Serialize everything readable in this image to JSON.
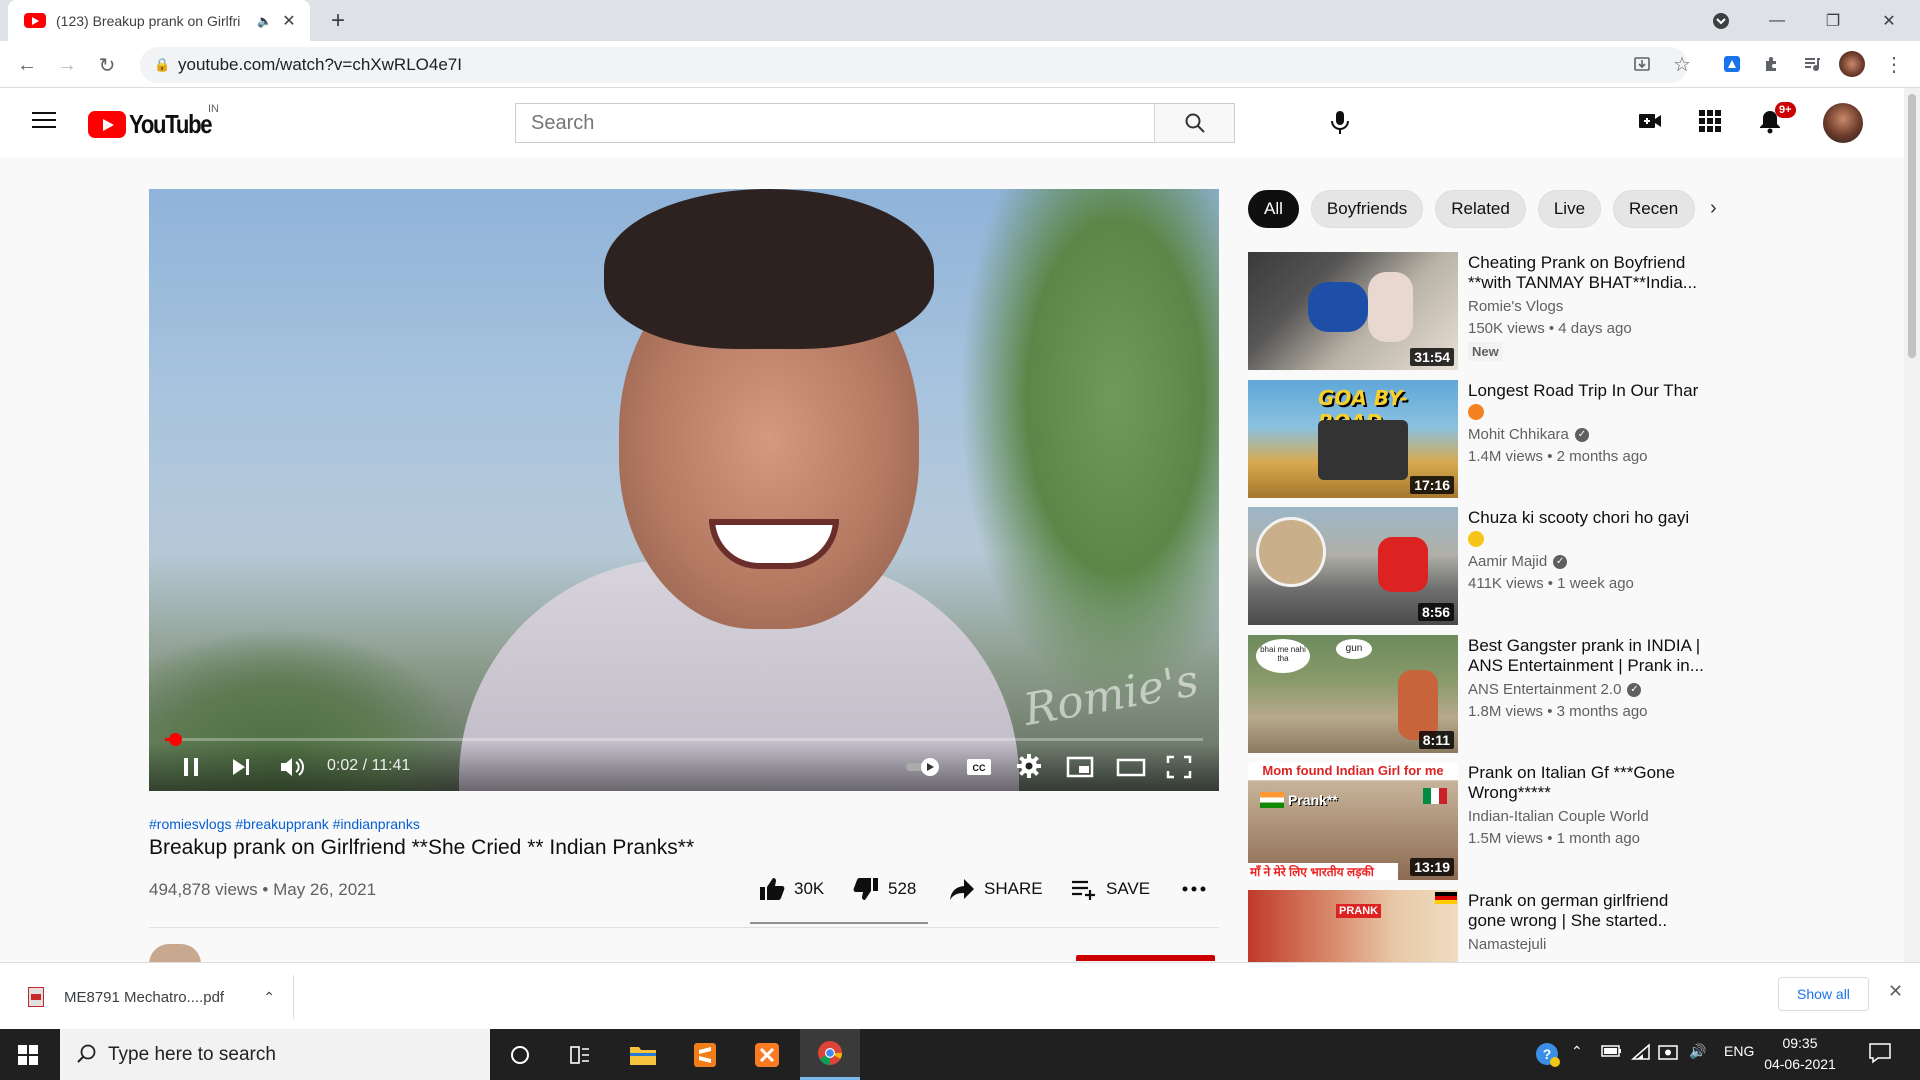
{
  "browser": {
    "tab_title": "(123) Breakup prank on Girlfri",
    "url": "youtube.com/watch?v=chXwRLO4e7I"
  },
  "youtube": {
    "logo_text": "YouTube",
    "country_code": "IN",
    "search_placeholder": "Search",
    "notification_count": "9+"
  },
  "player": {
    "current_time": "0:02 / 11:41",
    "progress": 0.003,
    "watermark": "Romie's"
  },
  "video": {
    "hashtags": "#romiesvlogs #breakupprank #indianpranks",
    "title": "Breakup prank on Girlfriend **She Cried ** Indian Pranks**",
    "stats": "494,878 views • May 26, 2021",
    "likes": "30K",
    "dislikes": "528",
    "share_label": "SHARE",
    "save_label": "SAVE"
  },
  "chips": [
    "All",
    "Boyfriends",
    "Related",
    "Live",
    "Recen"
  ],
  "recommendations": [
    {
      "title": "Cheating Prank on Boyfriend **with TANMAY BHAT**India...",
      "channel": "Romie's Vlogs",
      "verified": false,
      "meta": "150K views • 4 days ago",
      "badge": "New",
      "duration": "31:54",
      "emoji": false
    },
    {
      "title": "Longest Road Trip In Our Thar",
      "channel": "Mohit Chhikara",
      "verified": true,
      "meta": "1.4M views • 2 months ago",
      "badge": "",
      "duration": "17:16",
      "emoji": true
    },
    {
      "title": "Chuza ki scooty chori ho gayi",
      "channel": "Aamir Majid",
      "verified": true,
      "meta": "411K views • 1 week ago",
      "badge": "",
      "duration": "8:56",
      "emoji": true
    },
    {
      "title": "Best Gangster prank in INDIA | ANS Entertainment | Prank in...",
      "channel": "ANS Entertainment 2.0",
      "verified": true,
      "meta": "1.8M views • 3 months ago",
      "badge": "",
      "duration": "8:11",
      "emoji": false
    },
    {
      "title": "Prank on Italian Gf ***Gone Wrong*****",
      "channel": "Indian-Italian Couple World",
      "verified": false,
      "meta": "1.5M views • 1 month ago",
      "badge": "",
      "duration": "13:19",
      "emoji": false
    },
    {
      "title": "Prank on german girlfriend ** gone wrong | She started...",
      "channel": "Namastejuli",
      "verified": false,
      "meta": "",
      "badge": "",
      "duration": "",
      "emoji": false
    }
  ],
  "thumb_texts": {
    "t2": "GOA BY-ROAD",
    "t4a": "bhai me nahi tha",
    "t4b": "gun",
    "t5a": "Mom found Indian Girl for me",
    "t5b": "Prank**",
    "t5c": "माँ ने मेरे लिए भारतीय लड़की",
    "t6": "PRANK"
  },
  "downloads": {
    "file_name": "ME8791 Mechatro....pdf",
    "show_all": "Show all"
  },
  "taskbar": {
    "search_placeholder": "Type here to search",
    "language": "ENG",
    "time": "09:35",
    "date": "04-06-2021"
  }
}
